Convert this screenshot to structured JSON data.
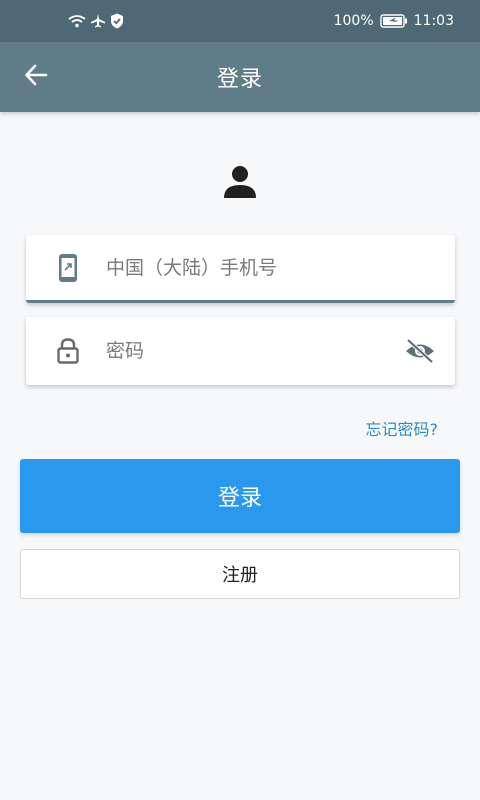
{
  "status_bar": {
    "battery": "100%",
    "time": "11:03",
    "icons": [
      "wifi-icon",
      "airplane-icon",
      "shield-check-icon",
      "battery-icon"
    ]
  },
  "app_bar": {
    "title": "登录",
    "back_icon": "arrow-left-icon"
  },
  "avatar": {
    "icon": "person-icon"
  },
  "form": {
    "phone": {
      "placeholder": "中国（大陆）手机号",
      "value": "",
      "icon": "phone-icon"
    },
    "password": {
      "placeholder": "密码",
      "value": "",
      "icon": "lock-icon",
      "toggle_icon": "eye-off-icon"
    },
    "forgot_label": "忘记密码?"
  },
  "buttons": {
    "login_label": "登录",
    "register_label": "注册"
  },
  "colors": {
    "status_bar": "#4e6975",
    "app_bar": "#5f7c88",
    "accent": "#2b98ef",
    "link": "#2f8cc0",
    "background": "#f7f8fa"
  }
}
